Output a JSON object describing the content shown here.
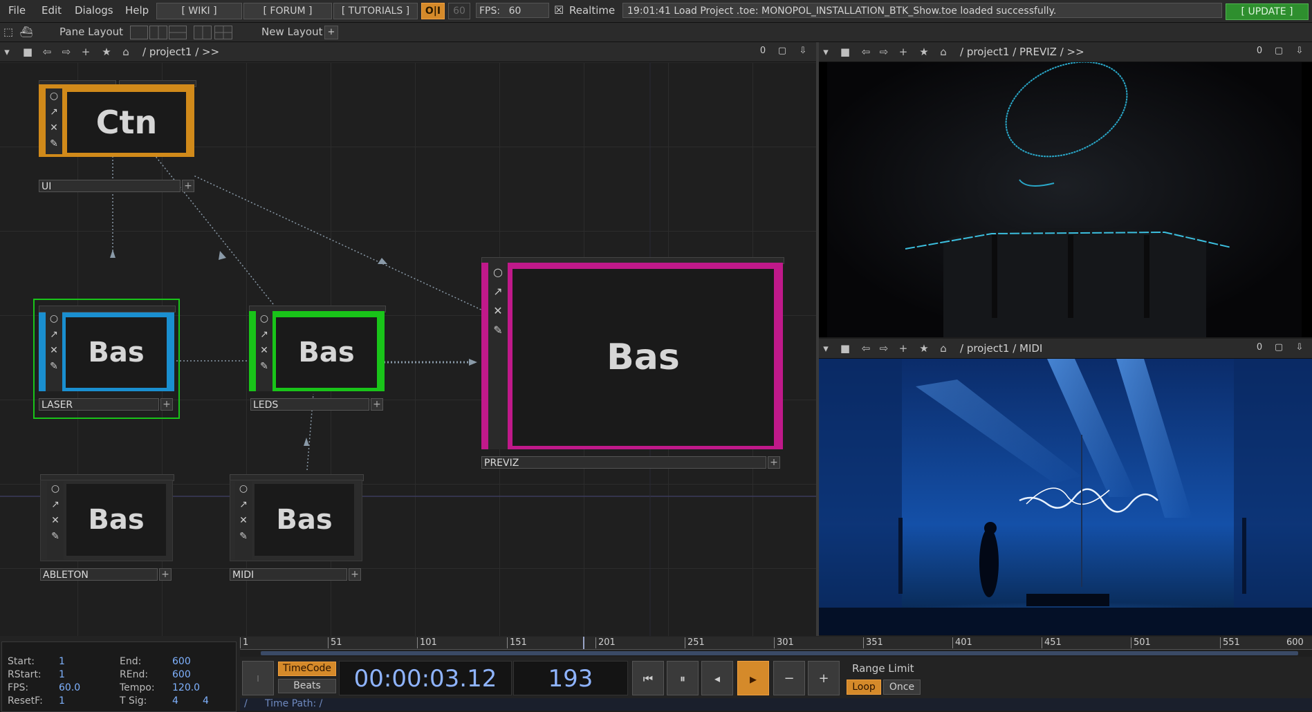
{
  "menu": {
    "file": "File",
    "edit": "Edit",
    "dialogs": "Dialogs",
    "help": "Help"
  },
  "topbar": {
    "wiki": "[ WIKI ]",
    "forum": "[ FORUM ]",
    "tutorials": "[ TUTORIALS ]",
    "oi": "O|I",
    "fps_cap": "60",
    "fps_label": "FPS:",
    "fps_value": "60",
    "realtime_check": "☒",
    "realtime": "Realtime",
    "status": "19:01:41 Load Project .toe: MONOPOL_INSTALLATION_BTK_Show.toe loaded successfully.",
    "update": "[ UPDATE ]"
  },
  "bar2": {
    "pane_layout": "Pane Layout",
    "new_layout": "New Layout",
    "plus": "+"
  },
  "network_path": {
    "path": "/  project1  /  >>",
    "counter": "0"
  },
  "previz_path": {
    "path": "/  project1  /  PREVIZ  /  >>",
    "counter": "0"
  },
  "midi_path": {
    "path": "/  project1  /  MIDI",
    "counter": "0"
  },
  "nodes": {
    "ui": {
      "type": "Ctn",
      "label": "UI"
    },
    "laser": {
      "type": "Bas",
      "label": "LASER"
    },
    "leds": {
      "type": "Bas",
      "label": "LEDS"
    },
    "previz": {
      "type": "Bas",
      "label": "PREVIZ"
    },
    "ableton": {
      "type": "Bas",
      "label": "ABLETON"
    },
    "midi": {
      "type": "Bas",
      "label": "MIDI"
    }
  },
  "node_icons": [
    "○",
    "↗",
    "✕",
    "✎"
  ],
  "colors": {
    "ui": "#d18a1a",
    "laser_outer": "#19c419",
    "laser_inner": "#1a8fd0",
    "leds": "#19c419",
    "previz": "#c0198a",
    "accent": "#e08a30"
  },
  "info": {
    "start_l": "Start:",
    "start_v": "1",
    "end_l": "End:",
    "end_v": "600",
    "rstart_l": "RStart:",
    "rstart_v": "1",
    "rend_l": "REnd:",
    "rend_v": "600",
    "fps_l": "FPS:",
    "fps_v": "60.0",
    "tempo_l": "Tempo:",
    "tempo_v": "120.0",
    "resetf_l": "ResetF:",
    "resetf_v": "1",
    "tsig_l": "T Sig:",
    "tsig_a": "4",
    "tsig_b": "4"
  },
  "ruler_ticks": [
    "1",
    "51",
    "101",
    "151",
    "201",
    "251",
    "301",
    "351",
    "401",
    "451",
    "501",
    "551",
    "600"
  ],
  "timeline": {
    "timecode": "TimeCode",
    "beats": "Beats",
    "time": "00:00:03.12",
    "frame": "193",
    "range_limit": "Range Limit",
    "loop": "Loop",
    "once": "Once",
    "time_path_prefix": "/",
    "time_path": "Time Path: /",
    "rewind": "⏮",
    "pause": "⏸",
    "step_back": "◂",
    "play": "▸",
    "minus": "−",
    "plus": "+",
    "side": "I"
  }
}
